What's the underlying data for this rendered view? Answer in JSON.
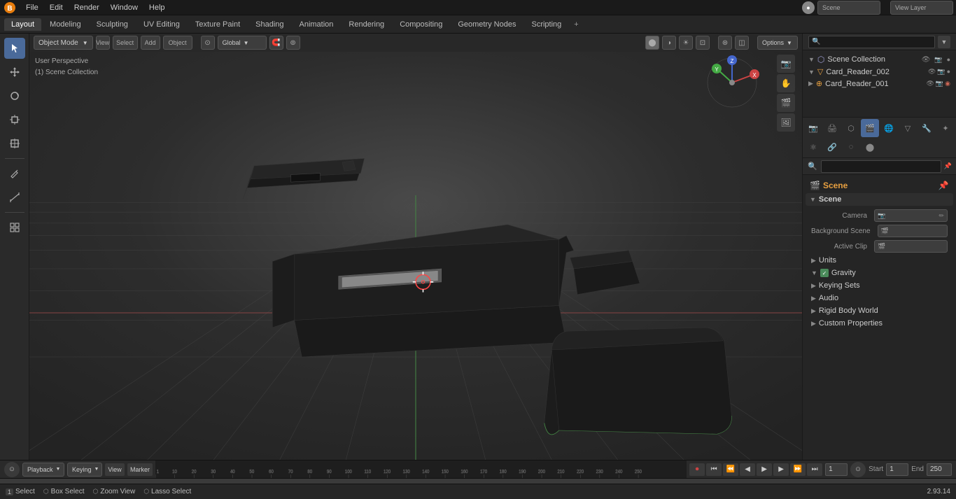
{
  "topMenu": {
    "logo": "●",
    "items": [
      "File",
      "Edit",
      "Render",
      "Window",
      "Help"
    ]
  },
  "workspaceTabs": {
    "tabs": [
      "Layout",
      "Modeling",
      "Sculpting",
      "UV Editing",
      "Texture Paint",
      "Shading",
      "Animation",
      "Rendering",
      "Compositing",
      "Geometry Nodes",
      "Scripting"
    ],
    "activeTab": "Layout"
  },
  "viewportHeader": {
    "objectMode": "Object Mode",
    "view": "View",
    "select": "Select",
    "add": "Add",
    "object": "Object",
    "transform": "Global",
    "options": "Options"
  },
  "viewportInfo": {
    "perspective": "User Perspective",
    "collection": "(1) Scene Collection"
  },
  "outliner": {
    "title": "Scene Collection",
    "items": [
      {
        "name": "Card_Reader_002",
        "indent": 1,
        "icon": "▼"
      },
      {
        "name": "Card_Reader_001",
        "indent": 2,
        "icon": "▶"
      }
    ]
  },
  "propertiesPanel": {
    "title": "Scene",
    "sections": {
      "scene": {
        "label": "Scene",
        "camera": {
          "label": "Camera",
          "value": ""
        },
        "backgroundScene": {
          "label": "Background Scene",
          "value": ""
        },
        "activeClip": {
          "label": "Active Clip",
          "value": ""
        }
      },
      "units": {
        "label": "Units"
      },
      "gravity": {
        "label": "Gravity",
        "checked": true
      },
      "keyingSets": {
        "label": "Keying Sets"
      },
      "audio": {
        "label": "Audio"
      },
      "rigidBodyWorld": {
        "label": "Rigid Body World"
      },
      "customProperties": {
        "label": "Custom Properties"
      }
    }
  },
  "timeline": {
    "playback": "Playback",
    "keying": "Keying",
    "view": "View",
    "marker": "Marker",
    "frame": "1",
    "start": "Start",
    "startVal": "1",
    "end": "End",
    "endVal": "250",
    "ticks": [
      1,
      10,
      20,
      30,
      40,
      50,
      60,
      70,
      80,
      90,
      100,
      110,
      120,
      130,
      140,
      150,
      160,
      170,
      180,
      190,
      200,
      210,
      220,
      230,
      240,
      250
    ]
  },
  "bottomBar": {
    "select": "Select",
    "boxSelect": "Box Select",
    "zoomView": "Zoom View",
    "lassoSelect": "Lasso Select",
    "version": "2.93.14"
  },
  "tools": {
    "icons": [
      "↔",
      "✥",
      "↺",
      "⊡",
      "⬡",
      "✏",
      "📐",
      "⚙",
      "🔗"
    ]
  }
}
